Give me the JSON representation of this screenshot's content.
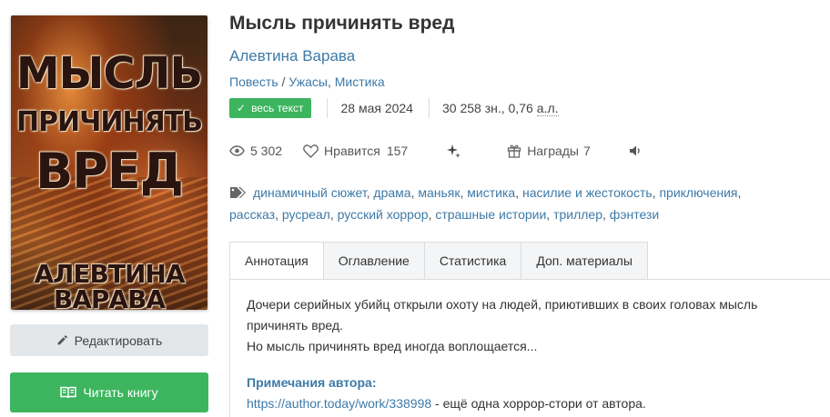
{
  "cover": {
    "title_line1": "МЫСЛЬ",
    "title_line2": "ПРИЧИНЯТЬ",
    "title_line3": "ВРЕД",
    "author_line1": "АЛЕВТИНА",
    "author_line2": "ВАРАВА"
  },
  "buttons": {
    "edit_label": "Редактировать",
    "read_label": "Читать книгу"
  },
  "book": {
    "title": "Мысль причинять вред",
    "author": "Алевтина Варава",
    "form": "Повесть",
    "genre_sep": " / ",
    "genre1": "Ужасы",
    "genre_comma": ", ",
    "genre2": "Мистика"
  },
  "meta": {
    "status_badge": "весь текст",
    "date": "28 мая 2024",
    "size": "30 258 зн., 0,76",
    "size_unit": "а.л."
  },
  "stats": {
    "views": "5 302",
    "likes_label": "Нравится",
    "likes_count": "157",
    "awards_label": "Награды",
    "awards_count": "7"
  },
  "tags": [
    "динамичный сюжет",
    "драма",
    "маньяк",
    "мистика",
    "насилие и жестокость",
    "приключения",
    "рассказ",
    "русреал",
    "русский хоррор",
    "страшные истории",
    "триллер",
    "фэнтези"
  ],
  "tabs": {
    "annotation": "Аннотация",
    "contents": "Оглавление",
    "statistics": "Статистика",
    "extras": "Доп. материалы"
  },
  "annotation": {
    "line1": "Дочери серийных убийц открыли охоту на людей, приютивших в своих головах мысль причинять вред.",
    "line2": "Но мысль причинять вред иногда воплощается...",
    "notes_title": "Примечания автора:",
    "notes_link": "https://author.today/work/338998",
    "notes_text": " - ещё одна хоррор-стори от автора."
  },
  "colors": {
    "accent_blue": "#3d7aa8",
    "green": "#3cb55e"
  }
}
